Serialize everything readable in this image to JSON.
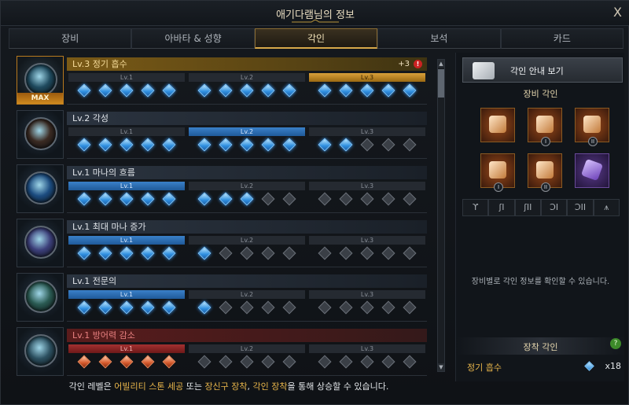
{
  "window": {
    "title": "애기다램님의 정보",
    "close_glyph": "X"
  },
  "tabs": [
    {
      "label": "장비",
      "active": false
    },
    {
      "label": "아바타 & 성향",
      "active": false
    },
    {
      "label": "각인",
      "active": true
    },
    {
      "label": "보석",
      "active": false
    },
    {
      "label": "카드",
      "active": false
    }
  ],
  "engravings": [
    {
      "title": "Lv.3 정기 흡수",
      "plus": "+3",
      "alert": "!",
      "style": "gold",
      "max_label": "MAX",
      "icon": "spirit-absorption-icon",
      "levels": [
        "Lv.1",
        "Lv.2",
        "Lv.3"
      ],
      "active_level": 3,
      "bar_style": "gold",
      "gems": [
        "blue",
        "blue",
        "blue",
        "blue",
        "blue",
        "blue",
        "blue",
        "blue",
        "blue",
        "blue",
        "blue",
        "blue",
        "blue",
        "blue",
        "blue"
      ]
    },
    {
      "title": "Lv.2 각성",
      "style": "normal",
      "icon": "awakening-icon",
      "levels": [
        "Lv.1",
        "Lv.2",
        "Lv.3"
      ],
      "active_level": 2,
      "bar_style": "blue",
      "gems": [
        "blue",
        "blue",
        "blue",
        "blue",
        "blue",
        "blue",
        "blue",
        "blue",
        "blue",
        "blue",
        "blue",
        "blue",
        "grey",
        "grey",
        "grey"
      ]
    },
    {
      "title": "Lv.1 마나의 흐름",
      "style": "normal",
      "icon": "mana-flow-icon",
      "levels": [
        "Lv.1",
        "Lv.2",
        "Lv.3"
      ],
      "active_level": 1,
      "bar_style": "blue",
      "gems": [
        "blue",
        "blue",
        "blue",
        "blue",
        "blue",
        "blue",
        "blue",
        "blue",
        "grey",
        "grey",
        "grey",
        "grey",
        "grey",
        "grey",
        "grey"
      ]
    },
    {
      "title": "Lv.1 최대 마나 증가",
      "style": "normal",
      "icon": "max-mana-icon",
      "levels": [
        "Lv.1",
        "Lv.2",
        "Lv.3"
      ],
      "active_level": 1,
      "bar_style": "blue",
      "gems": [
        "blue",
        "blue",
        "blue",
        "blue",
        "blue",
        "blue",
        "grey",
        "grey",
        "grey",
        "grey",
        "grey",
        "grey",
        "grey",
        "grey",
        "grey"
      ]
    },
    {
      "title": "Lv.1 전문의",
      "style": "normal",
      "icon": "expert-icon",
      "levels": [
        "Lv.1",
        "Lv.2",
        "Lv.3"
      ],
      "active_level": 1,
      "bar_style": "blue",
      "gems": [
        "blue",
        "blue",
        "blue",
        "blue",
        "blue",
        "blue",
        "grey",
        "grey",
        "grey",
        "grey",
        "grey",
        "grey",
        "grey",
        "grey",
        "grey"
      ]
    },
    {
      "title": "Lv.1 방어력 감소",
      "style": "red",
      "icon": "defense-reduction-icon",
      "levels": [
        "Lv.1",
        "Lv.2",
        "Lv.3"
      ],
      "active_level": 1,
      "bar_style": "red",
      "gems": [
        "red",
        "red",
        "red",
        "red",
        "red",
        "grey",
        "grey",
        "grey",
        "grey",
        "grey",
        "grey",
        "grey",
        "grey",
        "grey",
        "grey"
      ]
    }
  ],
  "scroll": {
    "up_glyph": "▲",
    "down_glyph": "▼"
  },
  "footer": {
    "p1": "각인 레벨은 ",
    "h1": "어빌리티 스톤 세공",
    "p2": " 또는 ",
    "h2": "장신구 장착",
    "p3": ", ",
    "h3": "각인 장착",
    "p4": "을 통해 상승할 수 있습니다."
  },
  "right_panel": {
    "guide_button": "각인 안내 보기",
    "equip_title": "장비 각인",
    "slots": [
      {
        "icon": "necklace-icon",
        "roman": "",
        "purple": false
      },
      {
        "icon": "earring-icon",
        "roman": "I",
        "purple": false
      },
      {
        "icon": "earring-icon",
        "roman": "II",
        "purple": false
      },
      {
        "icon": "ring-icon",
        "roman": "I",
        "purple": false
      },
      {
        "icon": "ring-icon",
        "roman": "II",
        "purple": false
      },
      {
        "icon": "ability-stone-icon",
        "roman": "",
        "purple": true
      }
    ],
    "slot_buttons": [
      "ϒ",
      "ʃI",
      "ʃII",
      "ƆI",
      "ƆII",
      "⩚"
    ],
    "equip_info": "장비별로 각인 정보를 확인할 수 있습니다.",
    "mount_title": "장착 각인",
    "help_glyph": "?",
    "mount_name": "정기 흡수",
    "mount_value": "x18"
  }
}
